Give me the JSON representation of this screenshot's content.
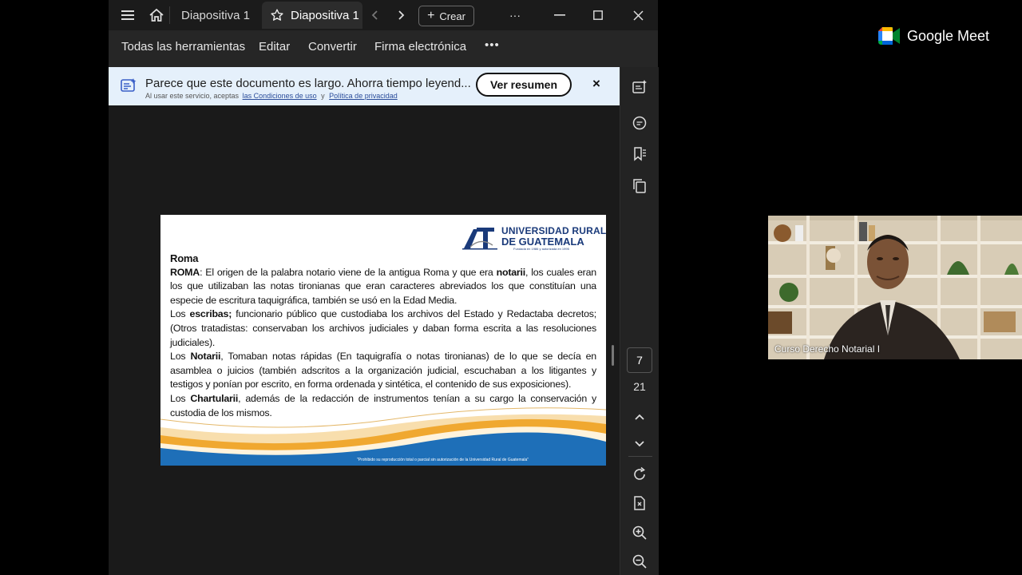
{
  "titlebar": {
    "tabs": [
      {
        "label": "Diapositiva 1",
        "active": false
      },
      {
        "label": "Diapositiva 1",
        "active": true
      }
    ],
    "create_label": "Crear",
    "more_label": "···"
  },
  "toolbar": {
    "items": [
      "Todas las herramientas",
      "Editar",
      "Convertir",
      "Firma electrónica"
    ],
    "more_label": "•••"
  },
  "banner": {
    "title": "Parece que este documento es largo. Ahorra tiempo leyend...",
    "sub_prefix": "Al usar este servicio, aceptas",
    "terms_link": "las Condiciones de uso",
    "sub_and": "y",
    "privacy_link": "Política de privacidad",
    "button": "Ver resumen",
    "close": "×"
  },
  "pager": {
    "current": "7",
    "total": "21"
  },
  "slide": {
    "logo_line1": "UNIVERSIDAD RURAL",
    "logo_line2": "DE GUATEMALA",
    "logo_tagline": "Fundada en 1986 y autorizada en 1995",
    "heading": "Roma",
    "p1_b1": "ROMA",
    "p1_t1": ": El origen de la palabra notario viene de la antigua Roma y que era ",
    "p1_b2": "notarii",
    "p1_t2": ", los cuales eran los que utilizaban las notas tironianas que eran caracteres abreviados los que constituían una especie de escritura taquigráfica, también se usó en la Edad Media.",
    "p2_t1": "Los ",
    "p2_b1": "escribas;",
    "p2_t2": " funcionario público que custodiaba los archivos del Estado y Redactaba decretos; (Otros tratadistas: conservaban los archivos judiciales y daban forma escrita a las resoluciones judiciales).",
    "p3_t1": "Los ",
    "p3_b1": "Notarii",
    "p3_t2": ", Tomaban notas rápidas (En taquigrafía o notas tironianas) de lo que se decía en asamblea o juicios (también adscritos a la organización judicial, escuchaban a los litigantes y testigos y ponían por escrito, en forma ordenada y sintética, el contenido de sus exposiciones).",
    "p4_t1": "Los ",
    "p4_b1": "Chartularii",
    "p4_t2": ", además de la redacción de instrumentos tenían a su cargo la conservación y custodia de los mismos.",
    "footnote": "\"Prohibido su reproducción total o parcial sin autorización de la Universidad Rural de Guatemala\""
  },
  "meet": {
    "brand": "Google Meet",
    "participant": "Curso Derecho Notarial I"
  },
  "colors": {
    "banner_bg": "#e5f0fb",
    "wave_blue": "#1e6fb8",
    "wave_orange": "#f0a830",
    "logo_blue": "#1a3a7a"
  }
}
